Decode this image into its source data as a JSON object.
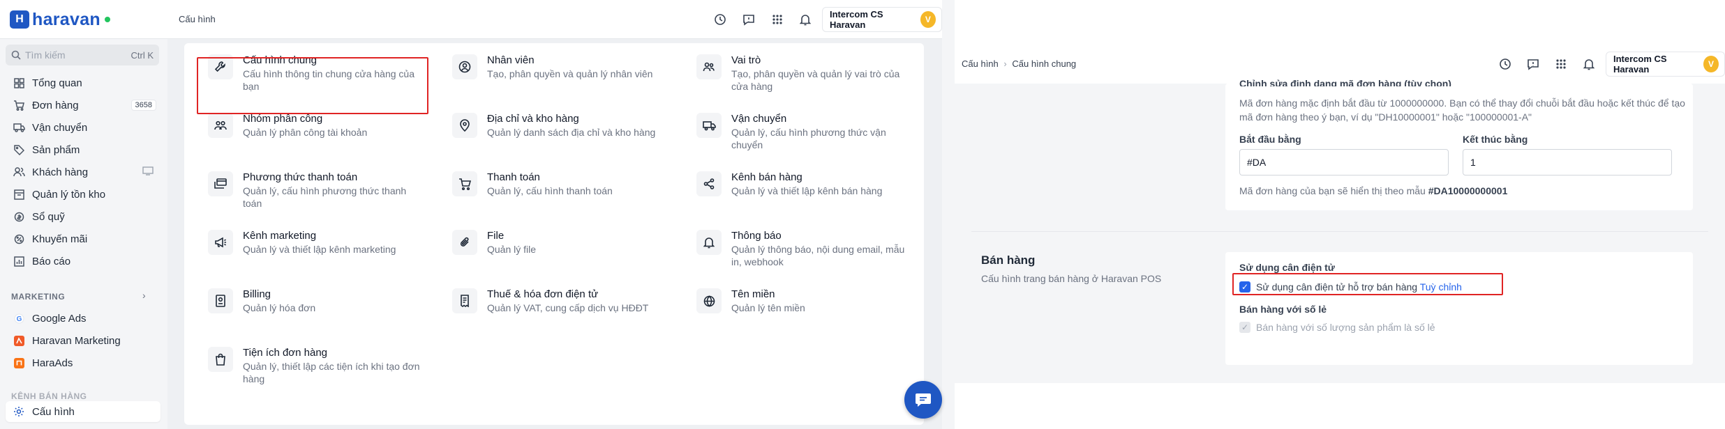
{
  "left": {
    "brand": {
      "name": "haravan",
      "mark": "H"
    },
    "breadcrumb": "Cấu hình",
    "user": {
      "name": "Intercom CS Haravan",
      "initial": "V"
    },
    "search": {
      "placeholder": "Tìm kiếm",
      "shortcut": "Ctrl K"
    },
    "nav": [
      {
        "label": "Tổng quan"
      },
      {
        "label": "Đơn hàng",
        "badge": "3658"
      },
      {
        "label": "Vận chuyển"
      },
      {
        "label": "Sản phẩm"
      },
      {
        "label": "Khách hàng"
      },
      {
        "label": "Quản lý tồn kho"
      },
      {
        "label": "Sổ quỹ"
      },
      {
        "label": "Khuyến mãi"
      },
      {
        "label": "Báo cáo"
      }
    ],
    "marketing_label": "MARKETING",
    "marketing": [
      {
        "label": "Google Ads"
      },
      {
        "label": "Haravan Marketing"
      },
      {
        "label": "HaraAds"
      }
    ],
    "channel_label": "KÊNH BÁN HÀNG",
    "active_item": "Cấu hình",
    "cards": [
      {
        "title": "Cấu hình chung",
        "desc": "Cấu hình thông tin chung cửa hàng của bạn"
      },
      {
        "title": "Nhân viên",
        "desc": "Tạo, phân quyền và quản lý nhân viên"
      },
      {
        "title": "Vai trò",
        "desc": "Tạo, phân quyền và quản lý vai trò của cửa hàng"
      },
      {
        "title": "Nhóm phân công",
        "desc": "Quản lý phân công tài khoản"
      },
      {
        "title": "Địa chỉ và kho hàng",
        "desc": "Quản lý danh sách địa chỉ và kho hàng"
      },
      {
        "title": "Vận chuyển",
        "desc": "Quản lý, cấu hình phương thức vận chuyển"
      },
      {
        "title": "Phương thức thanh toán",
        "desc": "Quản lý, cấu hình phương thức thanh toán"
      },
      {
        "title": "Thanh toán",
        "desc": "Quản lý, cấu hình thanh toán"
      },
      {
        "title": "Kênh bán hàng",
        "desc": "Quản lý và thiết lập kênh bán hàng"
      },
      {
        "title": "Kênh marketing",
        "desc": "Quản lý và thiết lập kênh marketing"
      },
      {
        "title": "File",
        "desc": "Quản lý file"
      },
      {
        "title": "Thông báo",
        "desc": "Quản lý thông báo, nội dung email, mẫu in, webhook"
      },
      {
        "title": "Billing",
        "desc": "Quản lý hóa đơn"
      },
      {
        "title": "Thuế & hóa đơn điện tử",
        "desc": "Quản lý VAT, cung cấp dịch vụ HĐĐT"
      },
      {
        "title": "Tên miền",
        "desc": "Quản lý tên miền"
      },
      {
        "title": "Tiện ích đơn hàng",
        "desc": "Quản lý, thiết lập các tiện ích khi tạo đơn hàng"
      }
    ]
  },
  "right": {
    "breadcrumb": {
      "parent": "Cấu hình",
      "current": "Cấu hình chung"
    },
    "user": {
      "name": "Intercom CS Haravan",
      "initial": "V"
    },
    "order_code": {
      "heading": "Chỉnh sửa định dạng mã đơn hàng (tùy chọn)",
      "desc": "Mã đơn hàng mặc định bắt đầu từ 1000000000. Bạn có thể thay đổi chuỗi bắt đầu hoặc kết thúc để tạo mã đơn hàng theo ý bạn, ví dụ \"DH10000001\" hoặc \"100000001-A\"",
      "prefix_label": "Bắt đầu bằng",
      "prefix_value": "#DA",
      "suffix_label": "Kết thúc bằng",
      "suffix_value": "1",
      "preview_text": "Mã đơn hàng của bạn sẽ hiển thị theo mẫu",
      "preview_value": "#DA10000000001"
    },
    "sales": {
      "title": "Bán hàng",
      "desc": "Cấu hình trang bán hàng ở Haravan POS",
      "scale_heading": "Sử dụng cân điện tử",
      "scale_option": "Sử dụng cân điện tử hỗ trợ bán hàng",
      "scale_link": "Tuỳ chỉnh",
      "decimal_heading": "Bán hàng với số lẻ",
      "decimal_option": "Bán hàng với số lượng sản phẩm là số lẻ"
    }
  }
}
